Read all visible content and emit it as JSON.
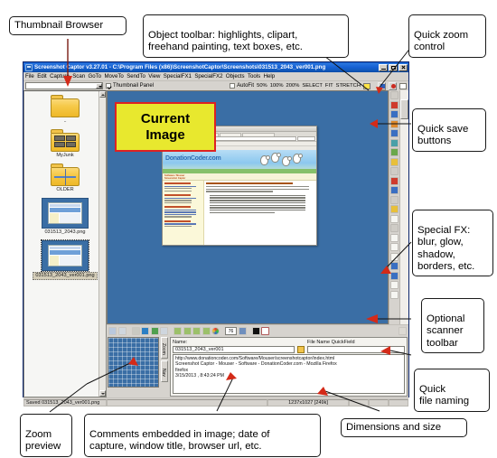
{
  "annotations": {
    "thumbnail_browser": "Thumbnail Browser",
    "object_toolbar": "Object toolbar: highlights, clipart,\nfreehand painting, text boxes, etc.",
    "quick_zoom": "Quick zoom\ncontrol",
    "quick_save": "Quick save\nbuttons",
    "special_fx": "Special FX:\nblur, glow,\nshadow,\nborders, etc.",
    "scanner_toolbar": "Optional\nscanner\ntoolbar",
    "quick_file_naming": "Quick\nfile naming",
    "zoom_preview": "Zoom\npreview",
    "comments_note": "Comments embedded in image; date of\ncapture, window title, browser url, etc.",
    "dimensions_note": "Dimensions and size"
  },
  "window": {
    "title": "Screenshot Captor v3.27.01 - C:\\Program Files (x86)\\ScreenshotCaptor\\Screenshots\\031513_2043_ver001.png",
    "icon": "app-icon",
    "buttons": {
      "minimize": "minimize-icon",
      "maximize": "maximize-icon",
      "close": "close-icon"
    }
  },
  "menu": [
    "File",
    "Edit",
    "Capture",
    "Scan",
    "GoTo",
    "MoveTo",
    "SendTo",
    "View",
    "SpecialFX1",
    "SpecialFX2",
    "Objects",
    "Tools",
    "Help"
  ],
  "toolbar": {
    "folder_combo_value": "",
    "thumbnail_panel_label": "Thumbnail Panel",
    "thumbnail_panel_checked": true,
    "autofit_label": "AutoFit",
    "autofit_checked": false,
    "zoom_buttons": [
      "50%",
      "100%",
      "200%",
      "SELECT",
      "FIT",
      "STRETCH"
    ],
    "color_swatch": "#ffe445",
    "quick_save_icons": [
      "save-disk-icon",
      "save-record-icon"
    ]
  },
  "thumbnails": [
    {
      "name": "..",
      "kind": "folder-up",
      "selected": false
    },
    {
      "name": "MyJunk",
      "kind": "folder-images",
      "selected": false
    },
    {
      "name": "OLDER",
      "kind": "folder-single",
      "selected": false
    },
    {
      "name": "031513_2043.png",
      "kind": "image",
      "selected": false
    },
    {
      "name": "031513_2043_ver001.png",
      "kind": "image",
      "selected": true
    }
  ],
  "canvas": {
    "highlight_text_line1": "Current",
    "highlight_text_line2": "Image",
    "highlight_fill": "#e8e82e",
    "highlight_border": "#dd2222",
    "background": "#3a6ea5",
    "shot": {
      "site_logo": "DonationCoder.com",
      "site_tagline": "Software / Mouser\nScreenshot Captor"
    }
  },
  "object_tools": [
    "arrow-tool-icon",
    "highlight-tool-icon",
    "stamp-tool-icon",
    "pencil-tool-icon",
    "text-tool-icon",
    "callout-tool-icon",
    "clipart-tool-icon",
    "erase-tool-icon",
    "note-tool-icon",
    "blur-fx-icon",
    "glow-fx-icon",
    "shadow-fx-icon",
    "link-fx-icon",
    "paint-fx-icon",
    "pointer-fx-icon",
    "select-fx-icon",
    "crop-fx-icon",
    "frame-fx-icon",
    "border-fx-icon",
    "resize-fx-icon",
    "page-fx-icon",
    "grid-fx-icon"
  ],
  "scanner_toolbar": {
    "icons": [
      "scan-icon",
      "scan-settings-icon",
      "cone-icon",
      "globe-icon",
      "square-icon",
      "mountain-icon",
      "img1-icon",
      "img2-icon",
      "img3-icon",
      "img4-icon",
      "color-wheel-icon",
      "rotate-icon",
      "effects-icon",
      "contrast-icon",
      "paper-icon"
    ],
    "spinner_value": "76"
  },
  "zoom_tabs": [
    "Zoom",
    "Nav"
  ],
  "fields": {
    "name_label": "Name:",
    "name_value": "031513_2043_ver001",
    "quickfield_label": "File Name QuickField",
    "quickfield_value": "",
    "lock_icon": "lock-icon",
    "comments": [
      "http://www.donationcoder.com/Software/Mouser/screenshotcaptor/index.html",
      "Screenshot Captor - Mouser - Software - DonationCoder.com - Mozilla Firefox",
      "firefox",
      "3/15/2013 , 8:43:24 PM"
    ]
  },
  "statusbar": {
    "saved_text": "Saved 031513_2043_ver001.png",
    "middle": "",
    "dimensions": "1237x1027  [249k]",
    "cell1": "",
    "cell2": "",
    "cell3": ""
  }
}
